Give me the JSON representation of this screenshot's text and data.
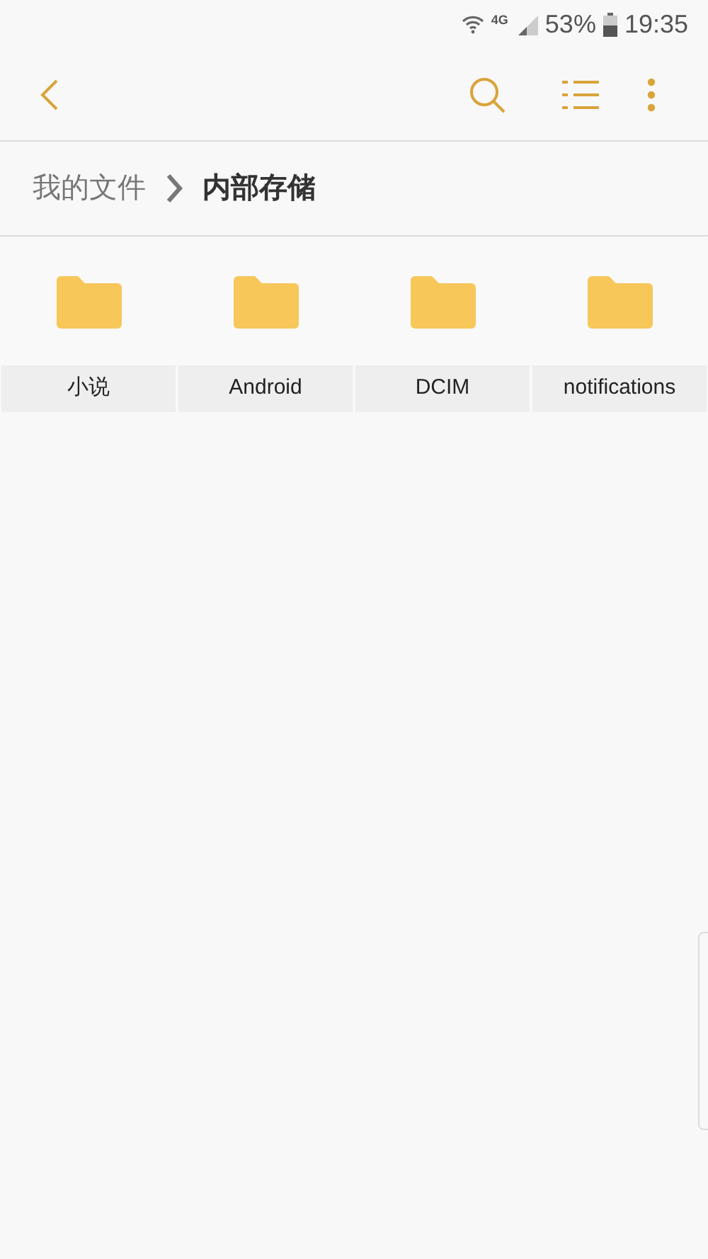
{
  "status_bar": {
    "network": "4G",
    "battery": "53%",
    "time": "19:35"
  },
  "breadcrumb": [
    {
      "label": "我的文件",
      "current": false
    },
    {
      "label": "内部存储",
      "current": true
    }
  ],
  "folders": [
    {
      "name": "小说"
    },
    {
      "name": "Android"
    },
    {
      "name": "DCIM"
    },
    {
      "name": "notifications"
    }
  ]
}
